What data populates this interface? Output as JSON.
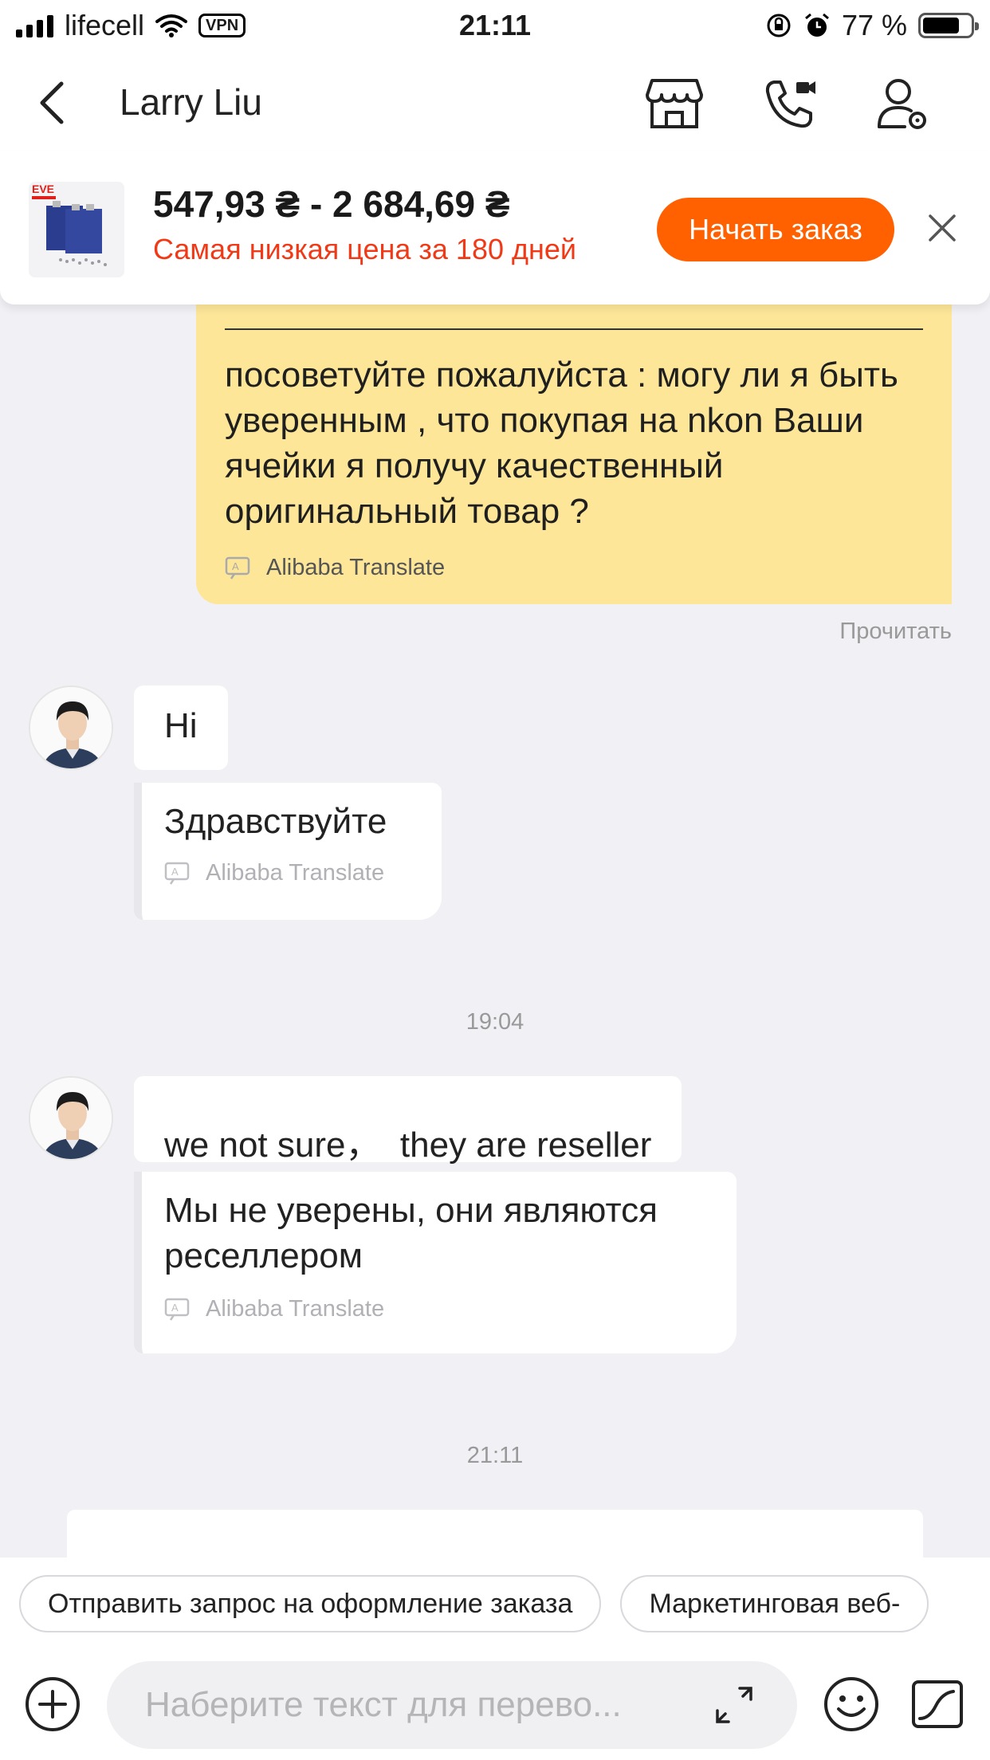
{
  "status_bar": {
    "carrier": "lifecell",
    "vpn": "VPN",
    "time": "21:11",
    "battery": "77 %",
    "battery_level": 0.77
  },
  "header": {
    "title": "Larry Liu",
    "icons": [
      "back-icon",
      "store-icon",
      "video-call-icon",
      "user-settings-icon"
    ]
  },
  "product": {
    "price": "547,93 ₴ - 2 684,69 ₴",
    "subtitle": "Самая низкая цена за 180 дней",
    "order_button": "Начать заказ",
    "thumb_brand": "EVE"
  },
  "messages": {
    "mine": {
      "text": "посоветуйте пожалуйста : могу ли я быть уверенным , что покупая на nkon Ваши ячейки я получу качественный оригинальный товар ?",
      "translate": "Alibaba Translate",
      "status": "Прочитать"
    },
    "m1": {
      "text": "Hi",
      "translation": "Здравствуйте",
      "translate": "Alibaba Translate"
    },
    "ts1": "19:04",
    "m2": {
      "text": "we not sure，  they are reseller",
      "translation": "Мы не уверены, они являются реселлером",
      "translate": "Alibaba Translate"
    },
    "ts2": "21:11"
  },
  "bottom": {
    "chips": [
      "Отправить запрос на оформление заказа",
      "Маркетинговая веб-"
    ],
    "input_placeholder": "Наберите текст для перево..."
  },
  "colors": {
    "accent": "#ff6000",
    "price_note": "#f03a17",
    "my_bubble": "#fde698",
    "background": "#f0f0f5"
  }
}
